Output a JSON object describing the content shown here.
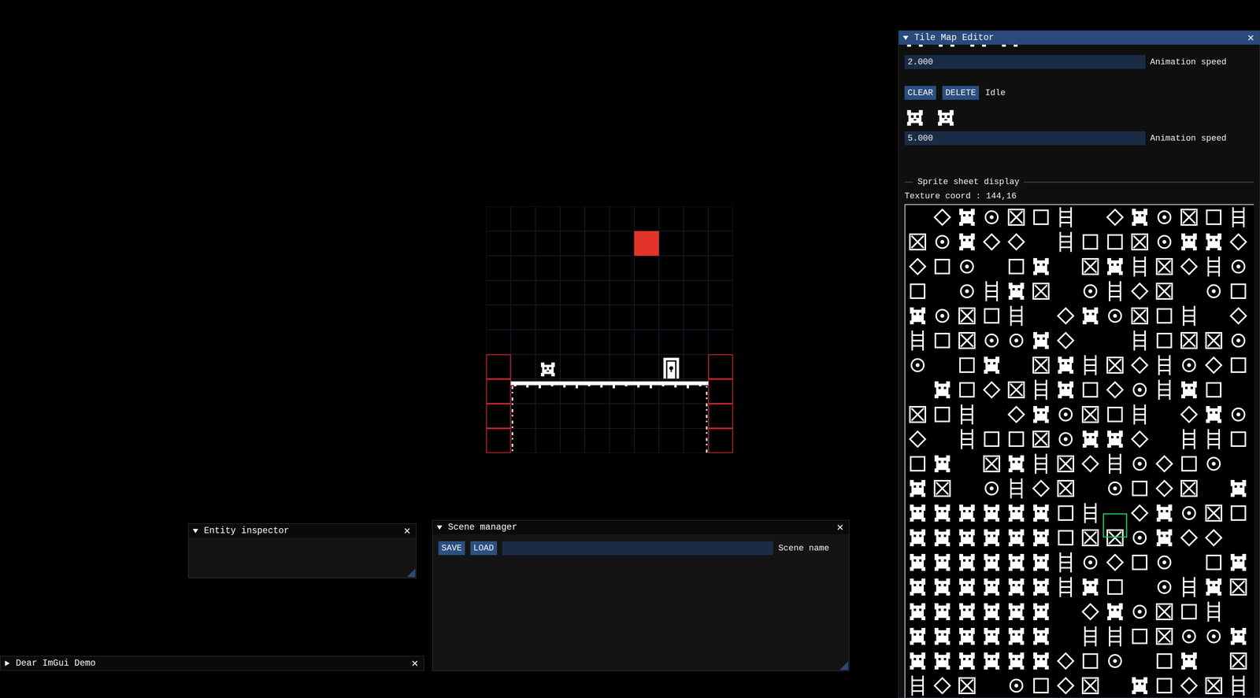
{
  "tile_map_editor": {
    "title": "Tile Map Editor",
    "expanded": true,
    "animations": [
      {
        "frames": 4,
        "buttons": [],
        "name": "",
        "speed": "2.000",
        "speed_label": "Animation speed"
      },
      {
        "frames": 2,
        "buttons": [
          "CLEAR",
          "DELETE"
        ],
        "name": "Idle",
        "speed": "5.000",
        "speed_label": "Animation speed"
      }
    ],
    "sprite_sheet": {
      "heading": "Sprite sheet display",
      "texture_coord": "Texture coord : 144,16"
    }
  },
  "entity_inspector": {
    "title": "Entity inspector",
    "expanded": true
  },
  "scene_manager": {
    "title": "Scene manager",
    "expanded": true,
    "buttons": [
      "SAVE",
      "LOAD"
    ],
    "scene_name": {
      "value": "",
      "label": "Scene name"
    }
  },
  "demo_window": {
    "title": "Dear ImGui Demo",
    "expanded": false
  }
}
